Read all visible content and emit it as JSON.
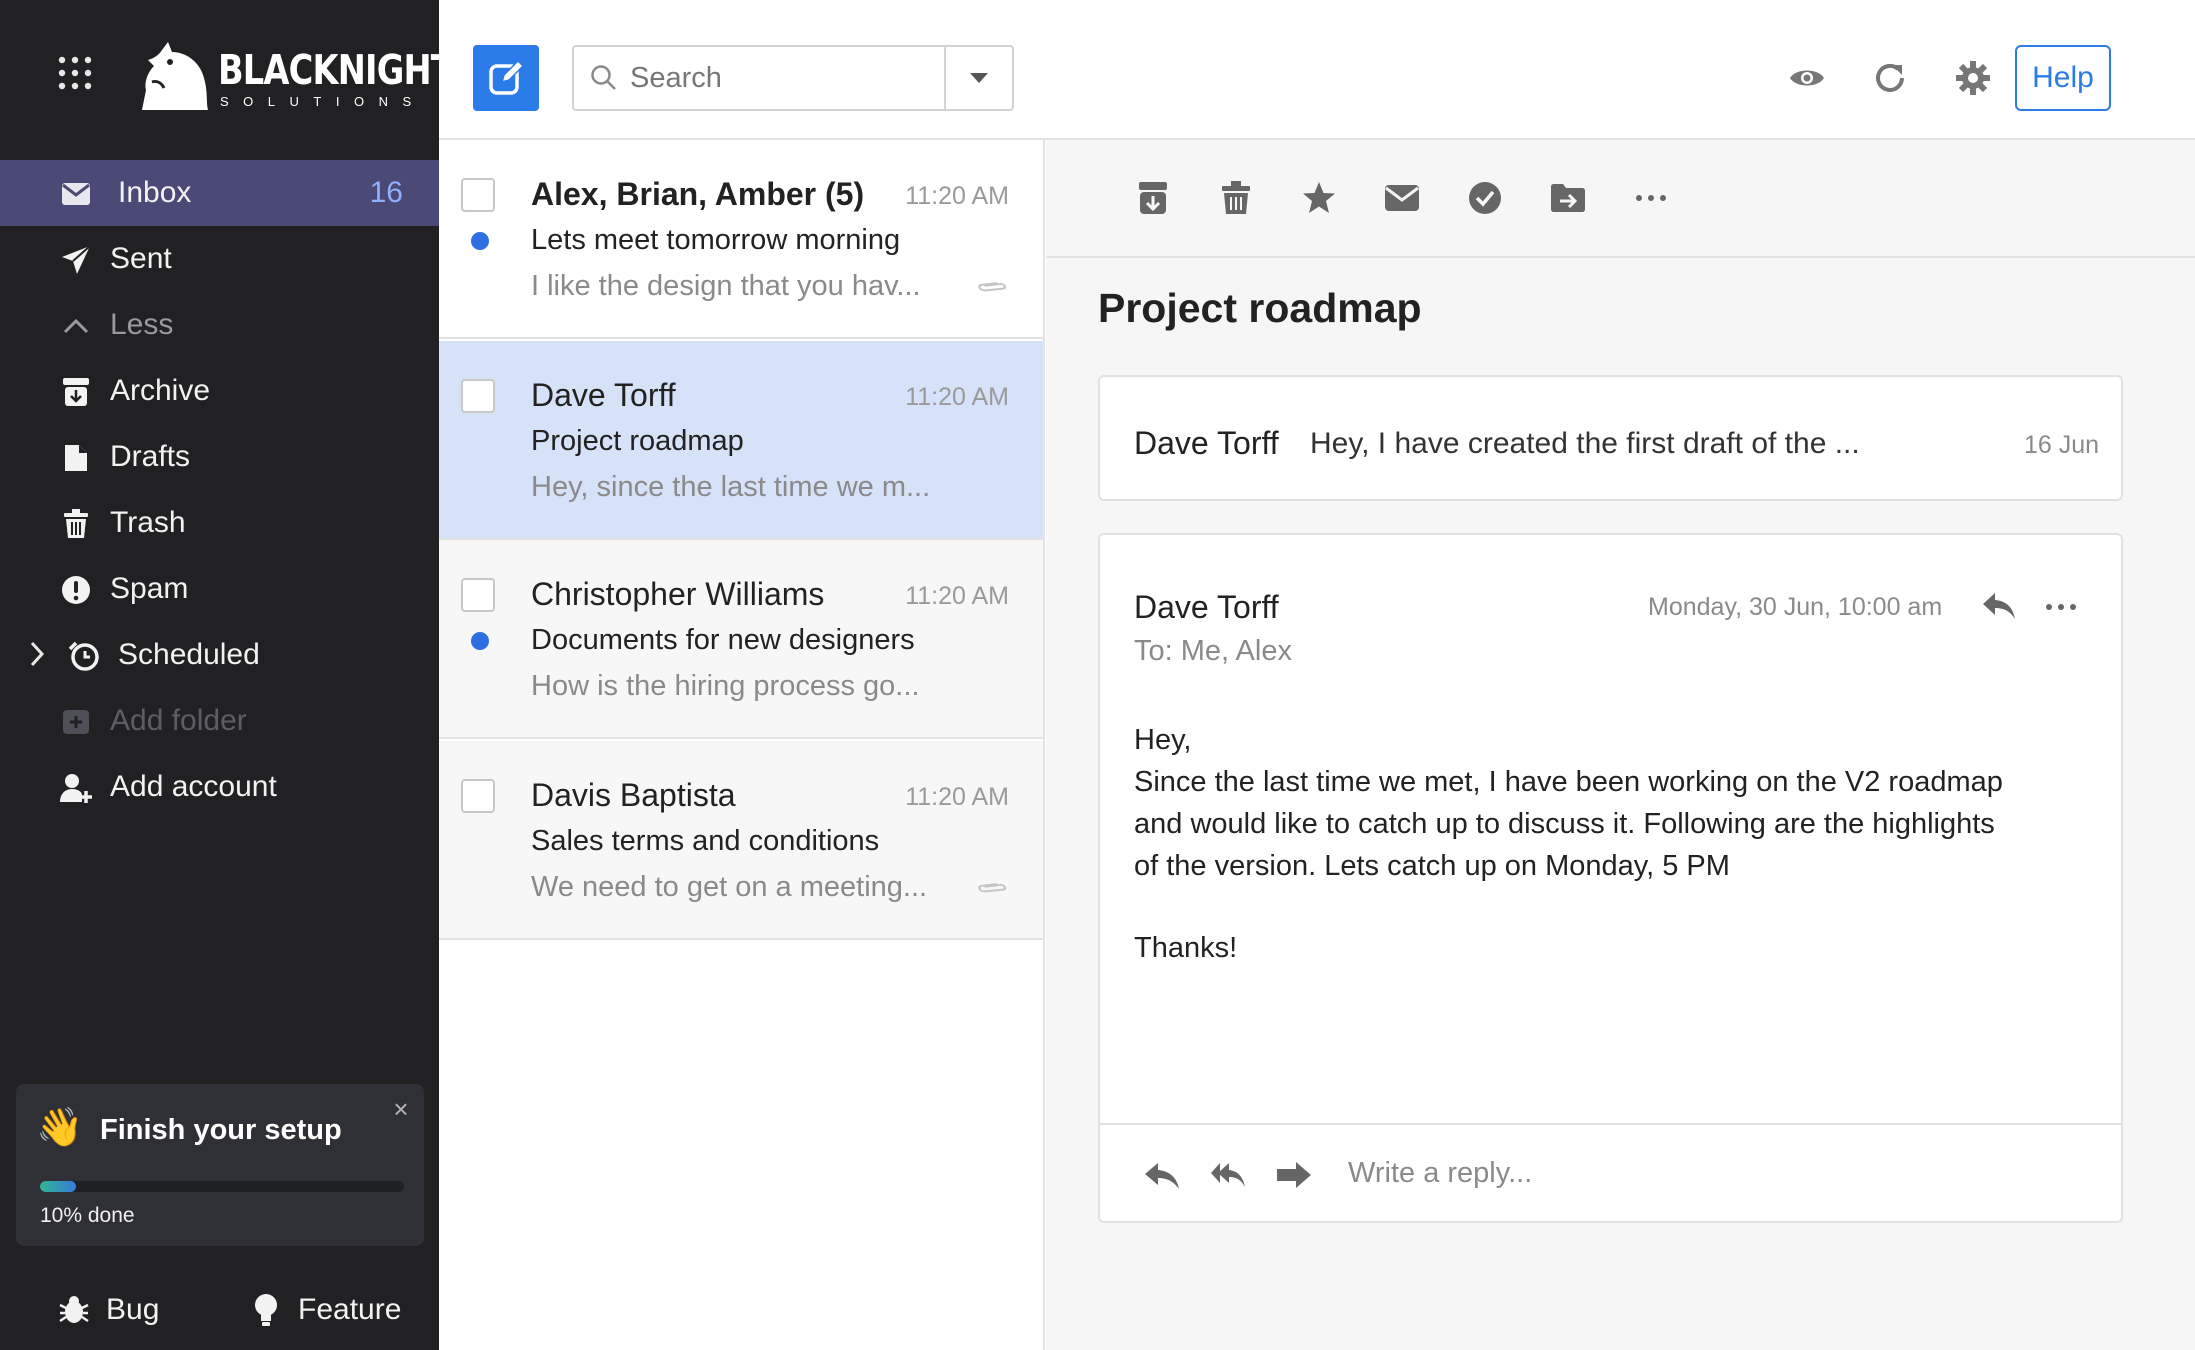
{
  "brand": {
    "name": "BLACKNIGHT",
    "tagline": "SOLUTIONS",
    "icon": "knight-logo"
  },
  "sidebar": {
    "items": [
      {
        "label": "Inbox",
        "icon": "envelope-icon",
        "count": "16"
      },
      {
        "label": "Sent",
        "icon": "paper-plane-icon"
      },
      {
        "label": "Less",
        "icon": "chevron-up-icon"
      },
      {
        "label": "Archive",
        "icon": "archive-icon"
      },
      {
        "label": "Drafts",
        "icon": "drafts-icon"
      },
      {
        "label": "Trash",
        "icon": "trash-icon"
      },
      {
        "label": "Spam",
        "icon": "spam-icon"
      },
      {
        "label": "Scheduled",
        "icon": "clock-icon"
      },
      {
        "label": "Add folder",
        "icon": "add-folder-icon"
      },
      {
        "label": "Add account",
        "icon": "add-user-icon"
      }
    ],
    "setup": {
      "emoji": "👋",
      "title": "Finish your setup",
      "progress": 0.1,
      "progress_label": "10% done",
      "close": "×"
    },
    "bottom": {
      "bug_label": "Bug",
      "feature_label": "Feature"
    }
  },
  "topbar": {
    "search_placeholder": "Search",
    "help_label": "Help"
  },
  "messages": [
    {
      "sender": "Alex, Brian, Amber (5)",
      "time": "11:20 AM",
      "subject": "Lets meet tomorrow morning",
      "preview": "I like the design that you hav...",
      "unread": true,
      "attachment": true,
      "selected": false
    },
    {
      "sender": "Dave Torff",
      "time": "11:20 AM",
      "subject": "Project roadmap",
      "preview": "Hey, since the last time we m...",
      "unread": false,
      "attachment": false,
      "selected": true
    },
    {
      "sender": "Christopher Williams",
      "time": "11:20 AM",
      "subject": "Documents for new designers",
      "preview": "How is the hiring process go...",
      "unread": true,
      "attachment": false,
      "selected": false
    },
    {
      "sender": "Davis Baptista",
      "time": "11:20 AM",
      "subject": "Sales terms and conditions",
      "preview": "We need to get on a meeting...",
      "unread": false,
      "attachment": true,
      "selected": false
    }
  ],
  "reading": {
    "subject": "Project roadmap",
    "collapsed": {
      "from": "Dave Torff",
      "snippet": "Hey, I have created the first draft of the ...",
      "date": "16 Jun"
    },
    "open": {
      "from": "Dave Torff",
      "to": "To: Me, Alex",
      "datetime": "Monday, 30 Jun, 10:00 am",
      "body": {
        "greeting": "Hey,",
        "line1": "Since the last time we met, I have been working on the V2 roadmap",
        "line2": "and would like to catch up to discuss it. Following are the highlights",
        "line3": "of the version. Lets catch up on Monday, 5 PM",
        "signoff": "Thanks!"
      }
    },
    "reply_placeholder": "Write a reply..."
  },
  "colors": {
    "sidebar_bg": "#212123",
    "active_item_bg": "#4b4a76",
    "accent": "#2b7be8",
    "unread_dot": "#2f6ee0",
    "selected_row": "#d5e2f8"
  }
}
